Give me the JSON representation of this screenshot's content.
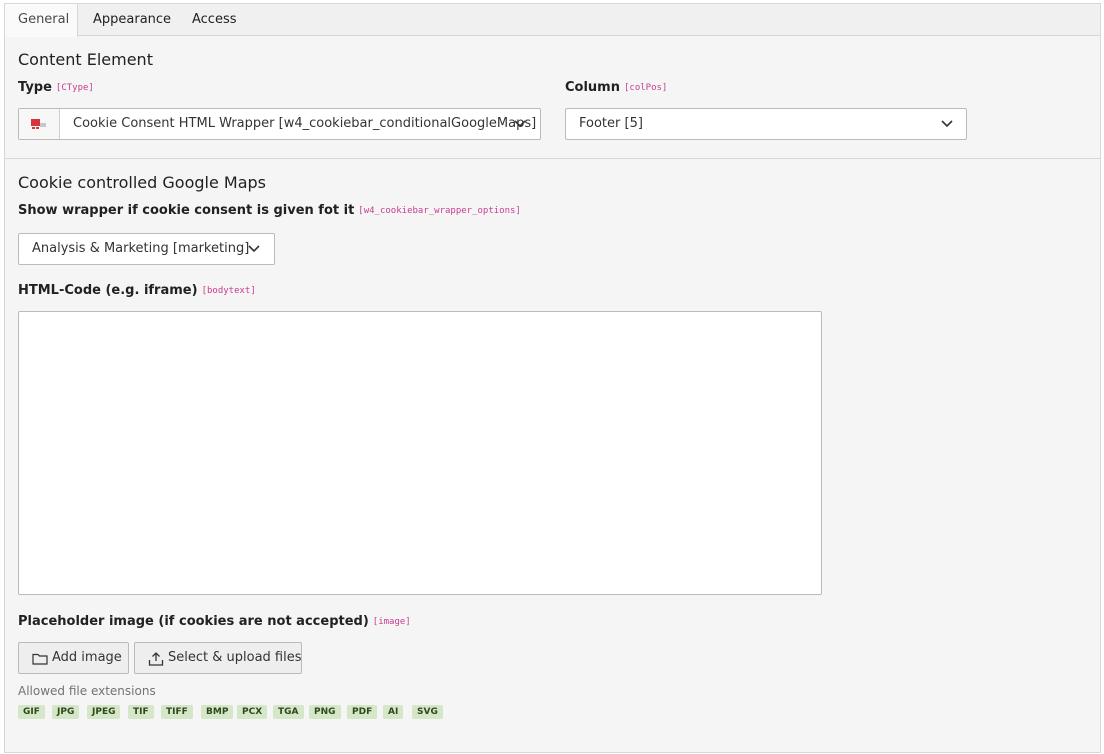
{
  "tabs": [
    {
      "label": "General"
    },
    {
      "label": "Appearance"
    },
    {
      "label": "Access"
    }
  ],
  "content_element": {
    "heading": "Content Element",
    "type": {
      "label": "Type",
      "code": "[CType]",
      "value": "Cookie Consent HTML Wrapper [w4_cookiebar_conditionalGoogleMaps]",
      "icon": "content-element-icon"
    },
    "column": {
      "label": "Column",
      "code": "[colPos]",
      "value": "Footer [5]"
    }
  },
  "maps_section": {
    "heading": "Cookie controlled Google Maps",
    "wrapper_option": {
      "label": "Show wrapper if cookie consent is given fot it",
      "code": "[w4_cookiebar_wrapper_options]",
      "value": "Analysis & Marketing [marketing]"
    },
    "html_code": {
      "label": "HTML-Code (e.g. iframe)",
      "code": "[bodytext]",
      "value": ""
    },
    "placeholder_image": {
      "label": "Placeholder image (if cookies are not accepted)",
      "code": "[image]",
      "add_button": "Add image",
      "upload_button": "Select & upload files",
      "allowed_label": "Allowed file extensions",
      "extensions": [
        "GIF",
        "JPG",
        "JPEG",
        "TIF",
        "TIFF",
        "BMP",
        "PCX",
        "TGA",
        "PNG",
        "PDF",
        "AI",
        "SVG"
      ]
    }
  },
  "colors": {
    "code_accent": "#c83c91",
    "extension_badge_bg": "#d6e6c8",
    "extension_badge_text": "#2c4a1a"
  }
}
